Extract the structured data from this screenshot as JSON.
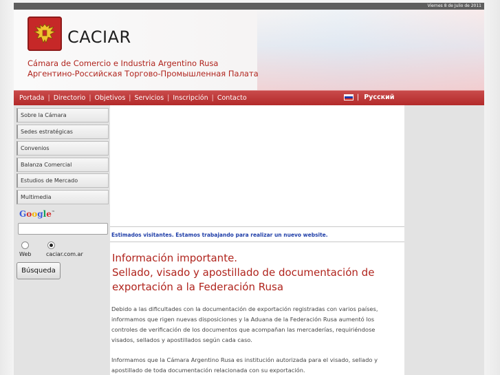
{
  "topbar": {
    "date": "Viernes 8 de Julio de 2011"
  },
  "header": {
    "brand": "CACIAR",
    "subtitle_es": "Cámara de Comercio e Industria Argentino Rusa",
    "subtitle_ru": "Аргентино-Российская Торгово-Промышленная Палата"
  },
  "nav": {
    "items": [
      {
        "label": "Portada"
      },
      {
        "label": "Directorio"
      },
      {
        "label": "Objetivos"
      },
      {
        "label": "Servicios"
      },
      {
        "label": "Inscripción"
      },
      {
        "label": "Contacto"
      }
    ],
    "separator": "|",
    "lang_label": "Русский",
    "lang_icon": "russia-flag-icon"
  },
  "sidebar": {
    "items": [
      {
        "label": "Sobre la Cámara"
      },
      {
        "label": "Sedes estratégicas"
      },
      {
        "label": "Convenios"
      },
      {
        "label": "Balanza Comercial"
      },
      {
        "label": "Estudios de Mercado"
      },
      {
        "label": "Multimedia"
      }
    ],
    "search": {
      "logo_text": "Google",
      "logo_tm": "™",
      "query": "",
      "options": [
        {
          "label": "Web",
          "checked": false
        },
        {
          "label": "caciar.com.ar",
          "checked": true
        }
      ],
      "button_label": "Búsqueda"
    }
  },
  "main": {
    "notice": "Estimados visitantes. Estamos trabajando para realizar un nuevo website.",
    "heading_lines": [
      "Información importante.",
      "Sellado, visado y apostillado de documentación de",
      "exportación a la Federación Rusa"
    ],
    "paragraph1_lines": [
      "Debido a las dificultades con la documentación de exportación registradas con varios países,",
      "informamos que rigen nuevas disposiciones y la Aduana de la Federación Rusa aumentó los",
      "controles de verificación de los documentos que acompañan las mercaderías, requiriéndose",
      "visados, sellados y apostillados según cada caso."
    ],
    "paragraph2_lines": [
      "Informamos que la Cámara Argentino Rusa es institución autorizada para el visado, sellado y",
      "apostillado de toda documentación relacionada con su exportación."
    ]
  },
  "colors": {
    "accent_red": "#b0241d",
    "nav_red": "#c03a3a",
    "notice_blue": "#1f3ea8"
  }
}
